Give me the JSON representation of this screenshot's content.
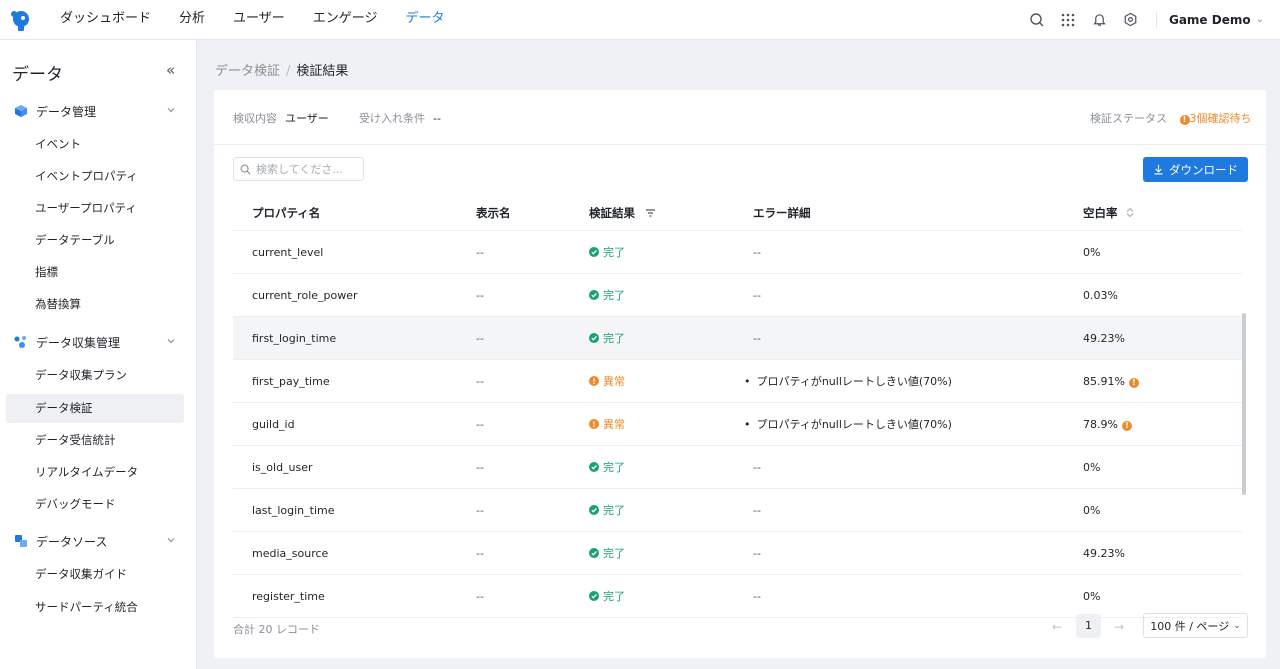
{
  "nav": {
    "items": [
      "ダッシュボード",
      "分析",
      "ユーザー",
      "エンゲージ",
      "データ"
    ],
    "active_index": 4,
    "project": "Game Demo",
    "icons": [
      "search-icon",
      "grid-icon",
      "bell-icon",
      "settings-icon"
    ]
  },
  "sidebar": {
    "title": "データ",
    "collapse_symbol": "«",
    "groups": [
      {
        "label": "データ管理",
        "items": [
          "イベント",
          "イベントプロパティ",
          "ユーザープロパティ",
          "データテーブル",
          "指標",
          "為替換算"
        ]
      },
      {
        "label": "データ収集管理",
        "items": [
          "データ収集プラン",
          "データ検証",
          "データ受信統計",
          "リアルタイムデータ",
          "デバッグモード"
        ]
      },
      {
        "label": "データソース",
        "items": [
          "データ収集ガイド",
          "サードパーティ統合"
        ]
      }
    ],
    "active_item": "データ検証"
  },
  "breadcrumb": {
    "prev": "データ検証",
    "sep": "/",
    "current": "検証結果"
  },
  "info": {
    "content_label": "検収内容",
    "content_value": "ユーザー",
    "cond_label": "受け入れ条件",
    "cond_value": "--",
    "status_label": "検証ステータス",
    "status_value": "3個確認待ち"
  },
  "search": {
    "placeholder": "検索してくださ..."
  },
  "download_label": "ダウンロード",
  "table": {
    "headers": [
      "プロパティ名",
      "表示名",
      "検証結果",
      "エラー詳細",
      "空白率"
    ],
    "rows": [
      {
        "name": "current_level",
        "display": "--",
        "result": "完了",
        "status": "ok",
        "error": "--",
        "blank": "0%",
        "warn": false
      },
      {
        "name": "current_role_power",
        "display": "--",
        "result": "完了",
        "status": "ok",
        "error": "--",
        "blank": "0.03%",
        "warn": false
      },
      {
        "name": "first_login_time",
        "display": "--",
        "result": "完了",
        "status": "ok",
        "error": "--",
        "blank": "49.23%",
        "warn": false
      },
      {
        "name": "first_pay_time",
        "display": "--",
        "result": "異常",
        "status": "ng",
        "error": "プロパティがnullレートしきい値(70%)",
        "blank": "85.91%",
        "warn": true
      },
      {
        "name": "guild_id",
        "display": "--",
        "result": "異常",
        "status": "ng",
        "error": "プロパティがnullレートしきい値(70%)",
        "blank": "78.9%",
        "warn": true
      },
      {
        "name": "is_old_user",
        "display": "--",
        "result": "完了",
        "status": "ok",
        "error": "--",
        "blank": "0%",
        "warn": false
      },
      {
        "name": "last_login_time",
        "display": "--",
        "result": "完了",
        "status": "ok",
        "error": "--",
        "blank": "0%",
        "warn": false
      },
      {
        "name": "media_source",
        "display": "--",
        "result": "完了",
        "status": "ok",
        "error": "--",
        "blank": "49.23%",
        "warn": false
      },
      {
        "name": "register_time",
        "display": "--",
        "result": "完了",
        "status": "ok",
        "error": "--",
        "blank": "0%",
        "warn": false
      }
    ]
  },
  "footer": {
    "total": "合計 20 レコード",
    "page": "1",
    "page_size": "100 件 / ページ"
  },
  "colors": {
    "accent": "#1f7ae0",
    "success": "#1aa36f",
    "warning": "#ee8a2a"
  }
}
